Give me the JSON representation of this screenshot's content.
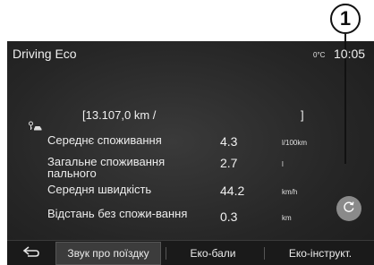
{
  "callout": {
    "number": "1"
  },
  "header": {
    "title": "Driving Eco",
    "temperature": "0°C",
    "time": "10:05"
  },
  "trip": {
    "open": "[13.107,0 km /",
    "close": "]"
  },
  "rows": [
    {
      "label": "Середнє споживання",
      "value": "4.3",
      "unit": "l/100km"
    },
    {
      "label": "Загальне споживання пального",
      "value": "2.7",
      "unit": "l"
    },
    {
      "label": "Середня швидкість",
      "value": "44.2",
      "unit": "km/h"
    },
    {
      "label": "Відстань без спожи-вання",
      "value": "0.3",
      "unit": "km"
    }
  ],
  "tabs": [
    {
      "label": "Звук про поїздку",
      "active": true
    },
    {
      "label": "Еко-бали",
      "active": false
    },
    {
      "label": "Еко-інструкт.",
      "active": false
    }
  ],
  "icons": {
    "back": "back-arrow-icon",
    "reset": "reset-icon",
    "trip": "key-car-icon"
  }
}
